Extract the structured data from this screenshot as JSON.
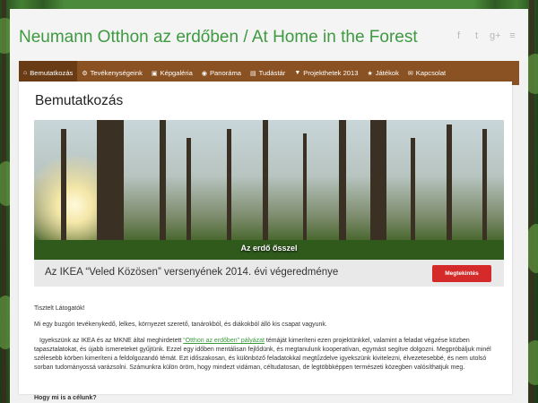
{
  "site": {
    "title": "Neumann Otthon az erdőben / At Home in the Forest",
    "social": [
      {
        "icon": "facebook-icon",
        "glyph": "f"
      },
      {
        "icon": "twitter-icon",
        "glyph": "t"
      },
      {
        "icon": "googleplus-icon",
        "glyph": "g+"
      },
      {
        "icon": "rss-icon",
        "glyph": "≡"
      }
    ]
  },
  "nav": {
    "items": [
      {
        "label": "Bemutatkozás",
        "icon": "home-icon",
        "glyph": "⌂"
      },
      {
        "label": "Tevékenységeink",
        "icon": "cogs-icon",
        "glyph": "⚙"
      },
      {
        "label": "Képgaléria",
        "icon": "picture-icon",
        "glyph": "▣"
      },
      {
        "label": "Panoráma",
        "icon": "eye-icon",
        "glyph": "◉"
      },
      {
        "label": "Tudástár",
        "icon": "book-icon",
        "glyph": "▤"
      },
      {
        "label": "Projekthetek 2013",
        "icon": "map-marker-icon",
        "glyph": "▼"
      },
      {
        "label": "Játékok",
        "icon": "trophy-icon",
        "glyph": "★"
      },
      {
        "label": "Kapcsolat",
        "icon": "envelope-icon",
        "glyph": "✉"
      }
    ]
  },
  "page": {
    "title": "Bemutatkozás",
    "banner_caption": "Az erdő ősszel",
    "promo_text": "Az IKEA “Veled Közösen” versenyének 2014. évi végeredménye",
    "promo_button": "Megtekintés",
    "greeting": "Tisztelt Látogatók!",
    "intro": "Mi egy buzgón tevékenykedő, lelkes, környezet szerető, tanárokból, és diákokból álló kis csapat vagyunk.",
    "paragraph_before_link": "Igyekszünk az IKEA és az MKNE által meghirdetett ",
    "paragraph_link": "“Otthon az erdőben” pályázat",
    "paragraph_after_link": " témáját kimeríteni ezen projektünkkel, valamint a feladat végzése közben tapasztalatokat, és újabb ismereteket gyűjtünk. Ezzel egy időben mentálisan fejlődünk, és megtanulunk kooperatívan, egymást segítve dolgozni. Megpróbáljuk minél szélesebb körben kimeríteni a feldolgozandó témát. Ezt időszakosan, és különböző feladatokkal megtűzdelve igyekszünk kivitelezni, élvezetesebbé, és nem utolsó sorban tudományossá varázsolni. Számunkra külön öröm, hogy mindezt vidáman, céltudatosan, de legtöbbképpen természeti közegben valósíthatjuk meg.",
    "subheading": "Hogy mi is a célunk?"
  },
  "colors": {
    "title_green": "#3d9a3f",
    "nav_brown": "#8a5222",
    "nav_active": "#6a3c16",
    "button_red": "#d42a2a"
  }
}
